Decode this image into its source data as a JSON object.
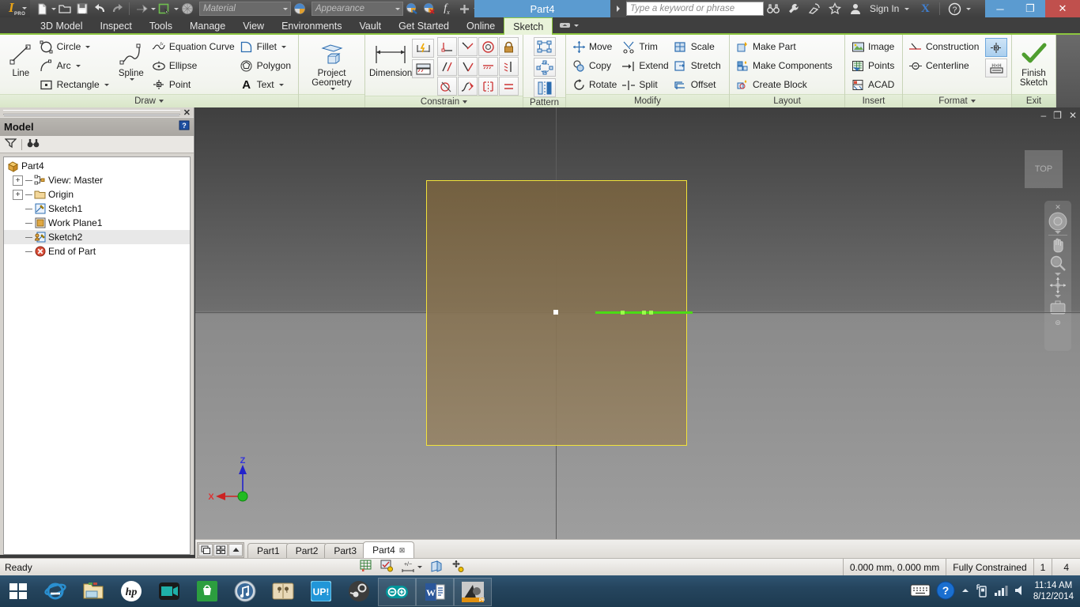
{
  "window": {
    "title": "Part4",
    "minimize_label": "─",
    "maximize_label": "❐",
    "close_label": "✕"
  },
  "quick_access": {
    "material_placeholder": "Material",
    "appearance_placeholder": "Appearance",
    "buttons": [
      {
        "name": "new-document",
        "icon": "new-file-icon"
      },
      {
        "name": "open-document",
        "icon": "open-folder-icon"
      },
      {
        "name": "save-document",
        "icon": "save-disk-icon"
      },
      {
        "name": "undo",
        "icon": "undo-arrow-icon"
      },
      {
        "name": "redo",
        "icon": "redo-arrow-icon"
      },
      {
        "name": "return",
        "icon": "return-icon"
      },
      {
        "name": "update",
        "icon": "update-icon"
      },
      {
        "name": "select",
        "icon": "select-sphere-icon"
      }
    ]
  },
  "search": {
    "placeholder": "Type a keyword or phrase"
  },
  "account": {
    "sign_in_label": "Sign In",
    "exchange_label": "X",
    "help_label": "?"
  },
  "ribbon_tabs": {
    "items": [
      {
        "label": "3D Model",
        "active": false
      },
      {
        "label": "Inspect",
        "active": false
      },
      {
        "label": "Tools",
        "active": false
      },
      {
        "label": "Manage",
        "active": false
      },
      {
        "label": "View",
        "active": false
      },
      {
        "label": "Environments",
        "active": false
      },
      {
        "label": "Vault",
        "active": false
      },
      {
        "label": "Get Started",
        "active": false
      },
      {
        "label": "Online",
        "active": false
      },
      {
        "label": "Sketch",
        "active": true
      }
    ]
  },
  "ribbon": {
    "panels": [
      {
        "title": "Draw",
        "has_arrow": true,
        "big": {
          "label": "Line",
          "icon": "line-icon"
        },
        "col_a": [
          {
            "label": "Circle",
            "icon": "circle-icon",
            "dropdown": true
          },
          {
            "label": "Arc",
            "icon": "arc-icon",
            "dropdown": true
          },
          {
            "label": "Rectangle",
            "icon": "rectangle-icon",
            "dropdown": true
          }
        ],
        "big2": {
          "label": "Spline",
          "icon": "spline-icon",
          "dropdown": true
        },
        "col_b": [
          {
            "label": "Equation Curve",
            "icon": "equation-curve-icon",
            "dropdown": false
          },
          {
            "label": "Ellipse",
            "icon": "ellipse-icon",
            "dropdown": false
          },
          {
            "label": "Point",
            "icon": "point-icon",
            "dropdown": false
          }
        ],
        "col_c": [
          {
            "label": "Fillet",
            "icon": "fillet-icon",
            "dropdown": true
          },
          {
            "label": "Polygon",
            "icon": "polygon-icon",
            "dropdown": false
          },
          {
            "label": "Text",
            "icon": "text-icon",
            "dropdown": true
          }
        ]
      },
      {
        "title": "",
        "has_arrow": false,
        "project": {
          "line1": "Project",
          "line2": "Geometry",
          "icon": "project-geometry-icon"
        }
      },
      {
        "title": "Constrain",
        "has_arrow": true,
        "dimension": {
          "label": "Dimension",
          "icon": "dimension-icon"
        },
        "small_stack": [
          {
            "name": "auto-dimension-icon"
          },
          {
            "name": "show-constraints-icon"
          }
        ],
        "grid": [
          {
            "name": "coincident-constraint-icon"
          },
          {
            "name": "collinear-constraint-icon"
          },
          {
            "name": "concentric-constraint-icon"
          },
          {
            "name": "fix-constraint-icon"
          },
          {
            "name": "parallel-constraint-icon"
          },
          {
            "name": "perpendicular-constraint-icon"
          },
          {
            "name": "horizontal-constraint-icon"
          },
          {
            "name": "vertical-constraint-icon"
          },
          {
            "name": "tangent-constraint-icon"
          },
          {
            "name": "smooth-constraint-icon"
          },
          {
            "name": "symmetric-constraint-icon"
          },
          {
            "name": "equal-constraint-icon"
          }
        ]
      },
      {
        "title": "Pattern",
        "has_arrow": false,
        "grid": [
          {
            "name": "rectangular-pattern-icon"
          },
          {
            "name": "circular-pattern-icon"
          },
          {
            "name": "mirror-icon"
          }
        ]
      },
      {
        "title": "Modify",
        "has_arrow": false,
        "col_a": [
          {
            "label": "Move",
            "icon": "move-icon"
          },
          {
            "label": "Copy",
            "icon": "copy-icon"
          },
          {
            "label": "Rotate",
            "icon": "rotate-icon"
          }
        ],
        "col_b": [
          {
            "label": "Trim",
            "icon": "trim-icon"
          },
          {
            "label": "Extend",
            "icon": "extend-icon"
          },
          {
            "label": "Split",
            "icon": "split-icon"
          }
        ],
        "col_c": [
          {
            "label": "Scale",
            "icon": "scale-icon"
          },
          {
            "label": "Stretch",
            "icon": "stretch-icon"
          },
          {
            "label": "Offset",
            "icon": "offset-icon"
          }
        ]
      },
      {
        "title": "Layout",
        "has_arrow": false,
        "col_a": [
          {
            "label": "Make Part",
            "icon": "make-part-icon"
          },
          {
            "label": "Make Components",
            "icon": "make-components-icon"
          },
          {
            "label": "Create Block",
            "icon": "create-block-icon"
          }
        ]
      },
      {
        "title": "Insert",
        "has_arrow": false,
        "col_a": [
          {
            "label": "Image",
            "icon": "image-icon"
          },
          {
            "label": "Points",
            "icon": "points-icon"
          },
          {
            "label": "ACAD",
            "icon": "acad-icon"
          }
        ]
      },
      {
        "title": "Format",
        "has_arrow": true,
        "col_a": [
          {
            "label": "Construction",
            "icon": "construction-icon"
          },
          {
            "label": "Centerline",
            "icon": "centerline-icon"
          }
        ],
        "grid": [
          {
            "name": "construction-toggle-icon",
            "selected": true
          },
          {
            "name": "driven-dimension-icon",
            "selected": false
          }
        ]
      },
      {
        "title": "Exit",
        "has_arrow": false,
        "finish": {
          "line1": "Finish",
          "line2": "Sketch",
          "icon": "green-check-icon"
        }
      }
    ]
  },
  "browser": {
    "header_title": "Model",
    "help_icon": "help-question-icon",
    "close_icon": "close-icon",
    "toolbar": [
      {
        "name": "filter-icon"
      },
      {
        "name": "find-binoculars-icon"
      }
    ],
    "tree": [
      {
        "label": "Part4",
        "icon": "part-cube-icon",
        "level": 0,
        "expander": "",
        "selected": false
      },
      {
        "label": "View: Master",
        "icon": "view-master-icon",
        "level": 1,
        "expander": "+",
        "selected": false
      },
      {
        "label": "Origin",
        "icon": "folder-icon",
        "level": 1,
        "expander": "+",
        "selected": false
      },
      {
        "label": "Sketch1",
        "icon": "sketch-icon",
        "level": 1,
        "expander": "",
        "selected": false
      },
      {
        "label": "Work Plane1",
        "icon": "work-plane-icon",
        "level": 1,
        "expander": "",
        "selected": false
      },
      {
        "label": "Sketch2",
        "icon": "sketch-active-icon",
        "level": 1,
        "expander": "",
        "selected": true
      },
      {
        "label": "End of Part",
        "icon": "end-of-part-icon",
        "level": 1,
        "expander": "",
        "selected": false
      }
    ]
  },
  "canvas": {
    "viewcube_label": "TOP",
    "nav_items": [
      {
        "name": "close-navbar-icon"
      },
      {
        "name": "full-navigation-wheel-icon"
      },
      {
        "name": "wheel-dropdown-icon"
      },
      {
        "name": "pan-hand-icon"
      },
      {
        "name": "zoom-magnifier-icon"
      },
      {
        "name": "zoom-dropdown-icon"
      },
      {
        "name": "orbit-icon"
      },
      {
        "name": "orbit-dropdown-icon"
      },
      {
        "name": "look-at-icon"
      },
      {
        "name": "navbar-options-icon"
      }
    ],
    "axes": [
      {
        "label": "Z",
        "color": "#2222cc"
      },
      {
        "label": "X",
        "color": "#cc2222"
      }
    ]
  },
  "doc_tabs": {
    "controls": [
      {
        "name": "cascade-windows-icon"
      },
      {
        "name": "tile-windows-icon"
      },
      {
        "name": "scroll-up-icon"
      }
    ],
    "items": [
      {
        "label": "Part1",
        "active": false,
        "closable": false
      },
      {
        "label": "Part2",
        "active": false,
        "closable": false
      },
      {
        "label": "Part3",
        "active": false,
        "closable": false
      },
      {
        "label": "Part4",
        "active": true,
        "closable": true
      }
    ]
  },
  "status_bar": {
    "ready_label": "Ready",
    "coordinates": "0.000 mm, 0.000 mm",
    "constraint_status": "Fully Constrained",
    "dimensions_count": "1",
    "constraints_count": "4",
    "tools": [
      {
        "name": "snap-to-grid-icon"
      },
      {
        "name": "constraint-inference-icon"
      },
      {
        "name": "dimension-input-icon"
      },
      {
        "name": "slice-graphics-icon"
      },
      {
        "name": "auto-project-icon"
      }
    ]
  },
  "taskbar": {
    "start_label": "start-windows-icon",
    "items": [
      {
        "name": "internet-explorer-icon",
        "running": false
      },
      {
        "name": "file-explorer-icon",
        "running": false
      },
      {
        "name": "hp-icon",
        "running": false
      },
      {
        "name": "camera-video-icon",
        "running": false
      },
      {
        "name": "windows-store-icon",
        "running": false
      },
      {
        "name": "itunes-icon",
        "running": false
      },
      {
        "name": "ebook-icon",
        "running": false
      },
      {
        "name": "up-icon",
        "running": false
      },
      {
        "name": "steam-icon",
        "running": false
      },
      {
        "name": "arduino-icon",
        "running": true
      },
      {
        "name": "word-icon",
        "running": true
      },
      {
        "name": "inventor-icon",
        "running": true
      }
    ],
    "tray": [
      {
        "name": "keyboard-icon"
      },
      {
        "name": "help-blue-icon"
      },
      {
        "name": "show-hidden-icons-icon"
      },
      {
        "name": "usb-device-icon"
      },
      {
        "name": "network-signal-icon"
      },
      {
        "name": "volume-icon"
      }
    ],
    "clock_time": "11:14 AM",
    "clock_date": "8/12/2014"
  },
  "colors": {
    "accent_green": "#8cc63f",
    "title_blue": "#5b9bd0",
    "close_red": "#c0504d",
    "sketch_plane_border": "#f2e33a",
    "selected_geometry": "#4bdb15"
  }
}
